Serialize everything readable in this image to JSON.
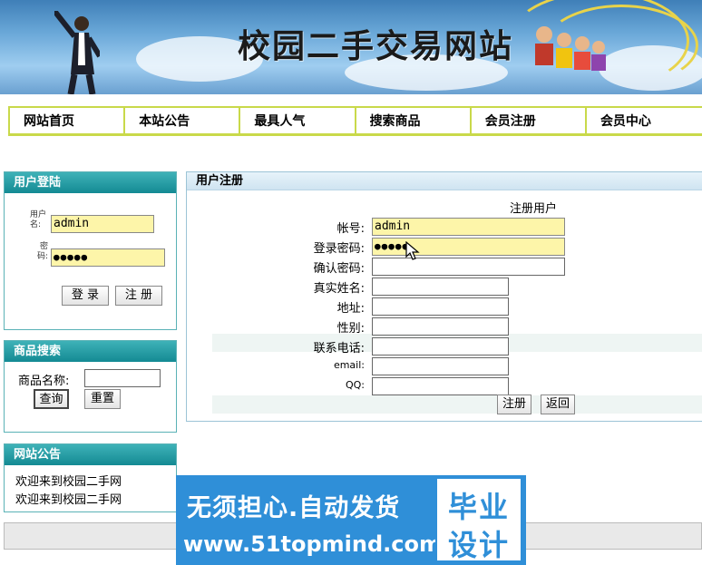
{
  "banner": {
    "title": "校园二手交易网站"
  },
  "nav": {
    "items": [
      {
        "label": "网站首页"
      },
      {
        "label": "本站公告"
      },
      {
        "label": "最具人气"
      },
      {
        "label": "搜索商品"
      },
      {
        "label": "会员注册"
      },
      {
        "label": "会员中心"
      }
    ]
  },
  "login": {
    "title": "用户登陆",
    "username_label": "用户名:",
    "username_value": "admin",
    "password_label": "密码:",
    "password_value": "●●●●●",
    "login_button": "登 录",
    "register_button": "注 册"
  },
  "search": {
    "title": "商品搜索",
    "name_label": "商品名称:",
    "name_value": "",
    "query_button": "查询",
    "reset_button": "重置"
  },
  "notice": {
    "title": "网站公告",
    "lines": [
      "欢迎来到校园二手网",
      "欢迎来到校园二手网"
    ]
  },
  "main": {
    "title": "用户注册",
    "form_title": "注册用户",
    "fields": [
      {
        "label": "帐号:",
        "value": "admin"
      },
      {
        "label": "登录密码:",
        "value": "●●●●●"
      },
      {
        "label": "确认密码:",
        "value": ""
      },
      {
        "label": "真实姓名:",
        "value": ""
      },
      {
        "label": "地址:",
        "value": ""
      },
      {
        "label": "性别:",
        "value": ""
      },
      {
        "label": "联系电话:",
        "value": ""
      },
      {
        "label": "email:",
        "value": ""
      },
      {
        "label": "QQ:",
        "value": ""
      }
    ],
    "submit_button": "注册",
    "back_button": "返回"
  },
  "ad": {
    "line1": "无须担心.自动发货",
    "line2": "www.51topmind.com",
    "badge_top": "毕业",
    "badge_bottom": "设计"
  }
}
